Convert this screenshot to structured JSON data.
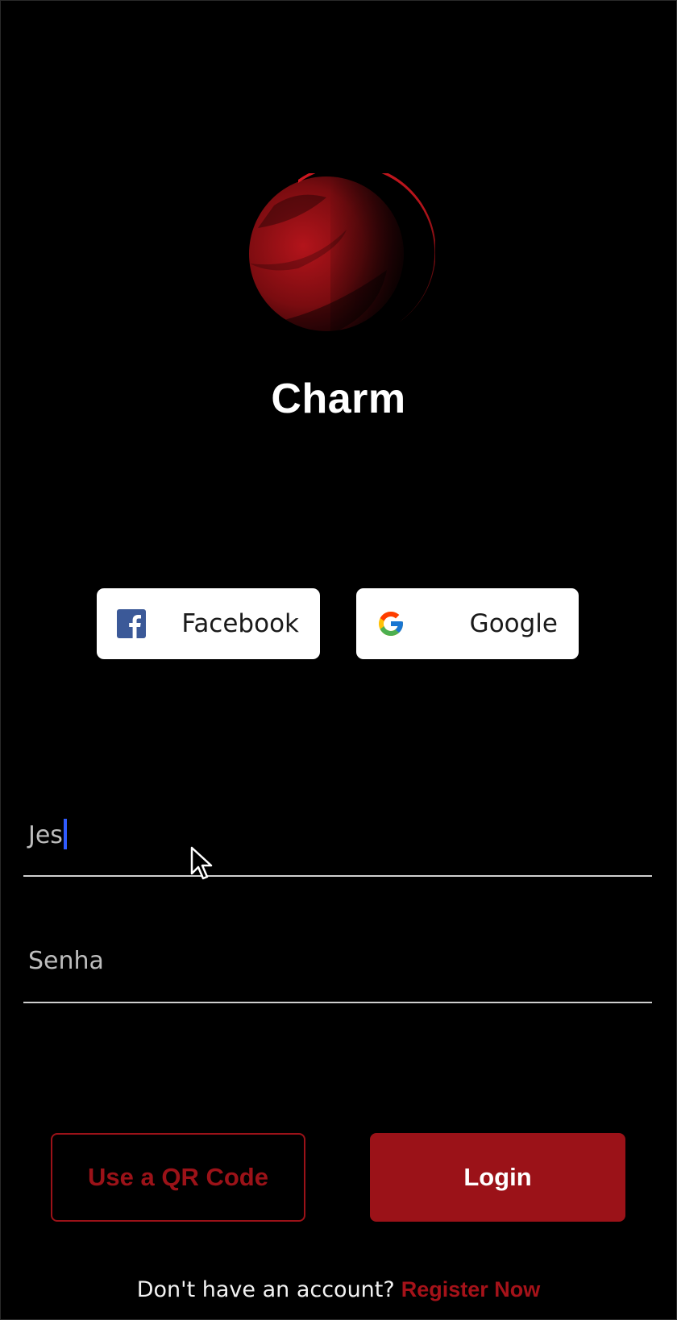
{
  "app": {
    "title": "Charm",
    "accent_color": "#9b1218"
  },
  "social": {
    "facebook": {
      "label": "Facebook",
      "icon": "facebook-icon"
    },
    "google": {
      "label": "Google",
      "icon": "google-icon"
    }
  },
  "form": {
    "username": {
      "value": "Jes"
    },
    "password": {
      "placeholder": "Senha"
    }
  },
  "actions": {
    "qr_label": "Use a QR Code",
    "login_label": "Login"
  },
  "footer": {
    "prompt": "Don't have an account?",
    "register_label": "Register Now"
  }
}
